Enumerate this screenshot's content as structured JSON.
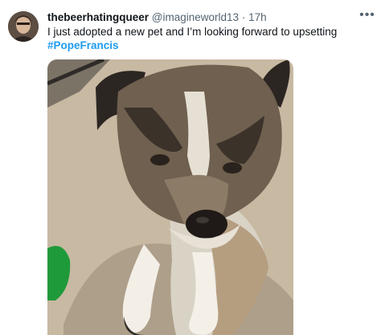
{
  "tweet": {
    "display_name": "thebeerhatingqueer",
    "handle": "@imagineworld13",
    "separator": "·",
    "time": "17h",
    "text": "I just adopted a new pet and I’m looking forward to upsetting",
    "hashtag": "#PopeFrancis",
    "more_icon": "more-horizontal-icon"
  },
  "colors": {
    "link": "#1d9bf0",
    "secondary_text": "#536471",
    "primary_text": "#0f1419"
  }
}
